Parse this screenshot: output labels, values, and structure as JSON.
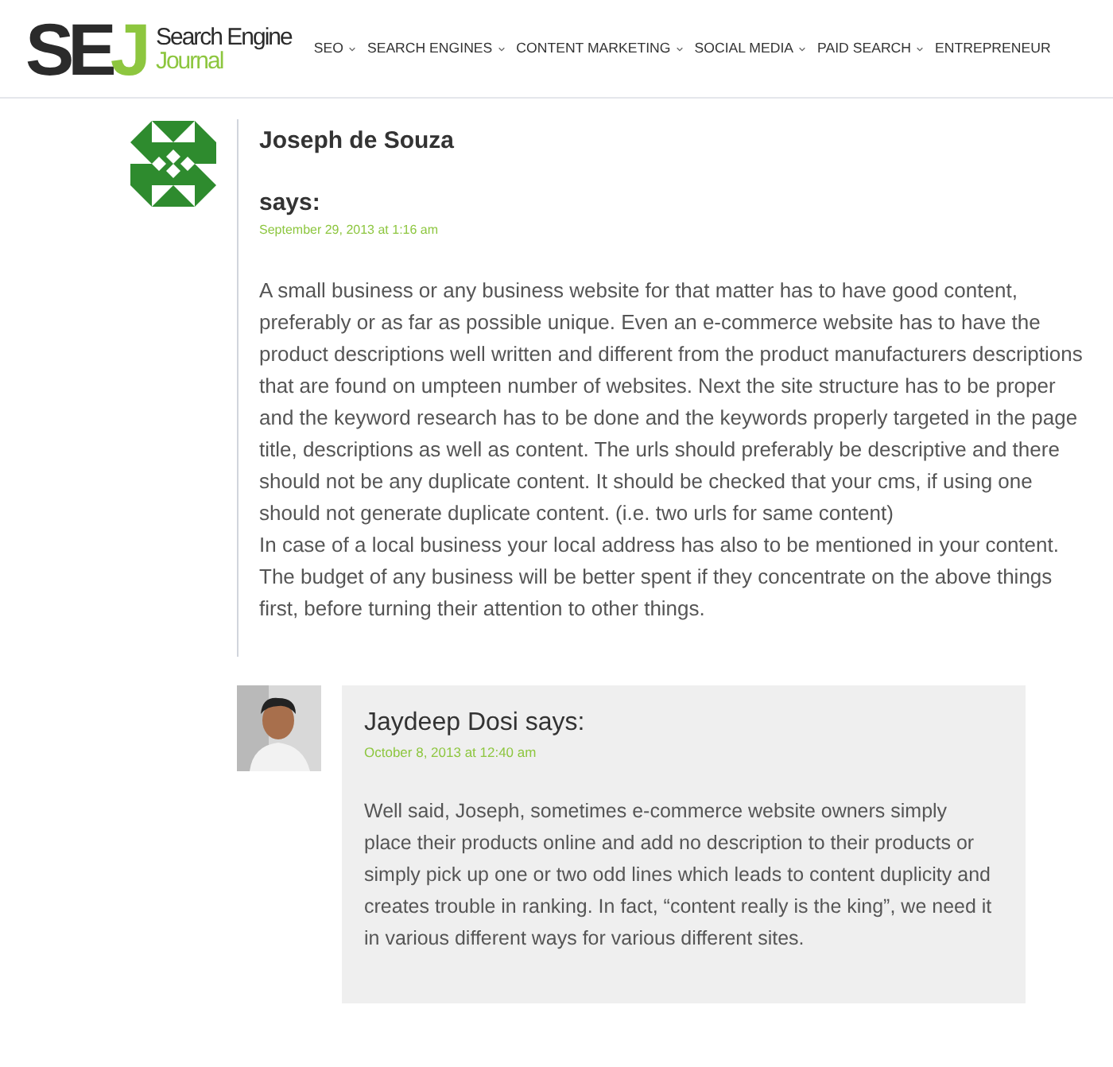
{
  "logo": {
    "mark": "SE",
    "mark_accent": "J",
    "line_1": "Search Engine",
    "line_2": "Journal"
  },
  "nav": [
    {
      "label": "SEO",
      "dropdown": true
    },
    {
      "label": "SEARCH ENGINES",
      "dropdown": true
    },
    {
      "label": "CONTENT MARKETING",
      "dropdown": true
    },
    {
      "label": "SOCIAL MEDIA",
      "dropdown": true
    },
    {
      "label": "PAID SEARCH",
      "dropdown": true
    },
    {
      "label": "ENTREPRENEUR",
      "dropdown": false
    }
  ],
  "comment": {
    "author": "Joseph de Souza",
    "says": "says:",
    "date": "September 29, 2013 at 1:16 am",
    "paragraphs": [
      "A small business or any business website for that matter has to have good content, preferably or as far as possible unique. Even an e-commerce website has to have the product descriptions well written and different from the product manufacturers descriptions that are found on umpteen number of websites. Next the site structure has to be proper and the keyword research has to be done and the keywords properly targeted in the page title, descriptions as well as content. The urls should preferably be descriptive and there should not be any duplicate content. It should be checked that your cms, if using one should not generate duplicate content. (i.e. two urls for same content)",
      "In case of a local business your local address has also to be mentioned in your content.",
      "The budget of any business will be better spent if they concentrate on the above things first, before turning their attention to other things."
    ]
  },
  "reply": {
    "author": "Jaydeep Dosi says:",
    "date": "October 8, 2013 at 12:40 am",
    "paragraphs": [
      "Well said, Joseph, sometimes e-commerce website owners simply place their products online and add no description to their products or simply pick up one or two odd lines which leads to content duplicity and creates trouble in ranking. In fact, “content really is the king”, we need it in various different ways for various different sites."
    ]
  }
}
